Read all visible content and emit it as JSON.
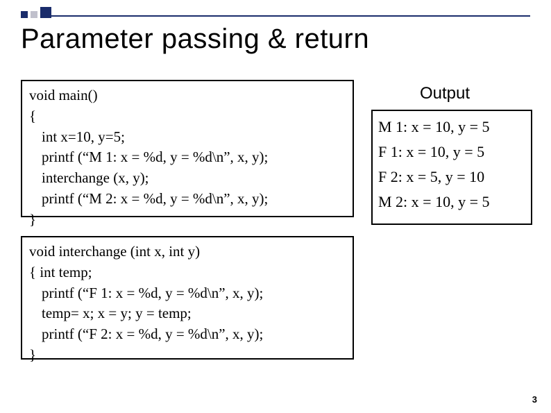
{
  "title": "Parameter passing & return",
  "code_main": {
    "l1": "void main()",
    "l2": "{",
    "l3": "int  x=10, y=5;",
    "l4": "printf  (“M 1:  x = %d, y = %d\\n”, x, y);",
    "l5": "interchange (x, y);",
    "l6": "printf  (“M 2:  x = %d, y = %d\\n”, x, y);",
    "l7": "}"
  },
  "code_inter": {
    "l1": "void interchange  (int x, int y)",
    "l2": "{ int temp;",
    "l3": "printf  (“F 1:  x = %d, y = %d\\n”, x, y);",
    "l4": "temp= x; x = y; y = temp;",
    "l5": "printf  (“F 2:  x = %d, y = %d\\n”, x, y);",
    "l6": "}"
  },
  "output": {
    "label": "Output",
    "r1": "M 1:  x = 10, y = 5",
    "r2": "F 1:  x = 10, y = 5",
    "r3": "F 2:  x = 5, y = 10",
    "r4": "M 2:  x = 10, y = 5"
  },
  "pagenum": "3"
}
